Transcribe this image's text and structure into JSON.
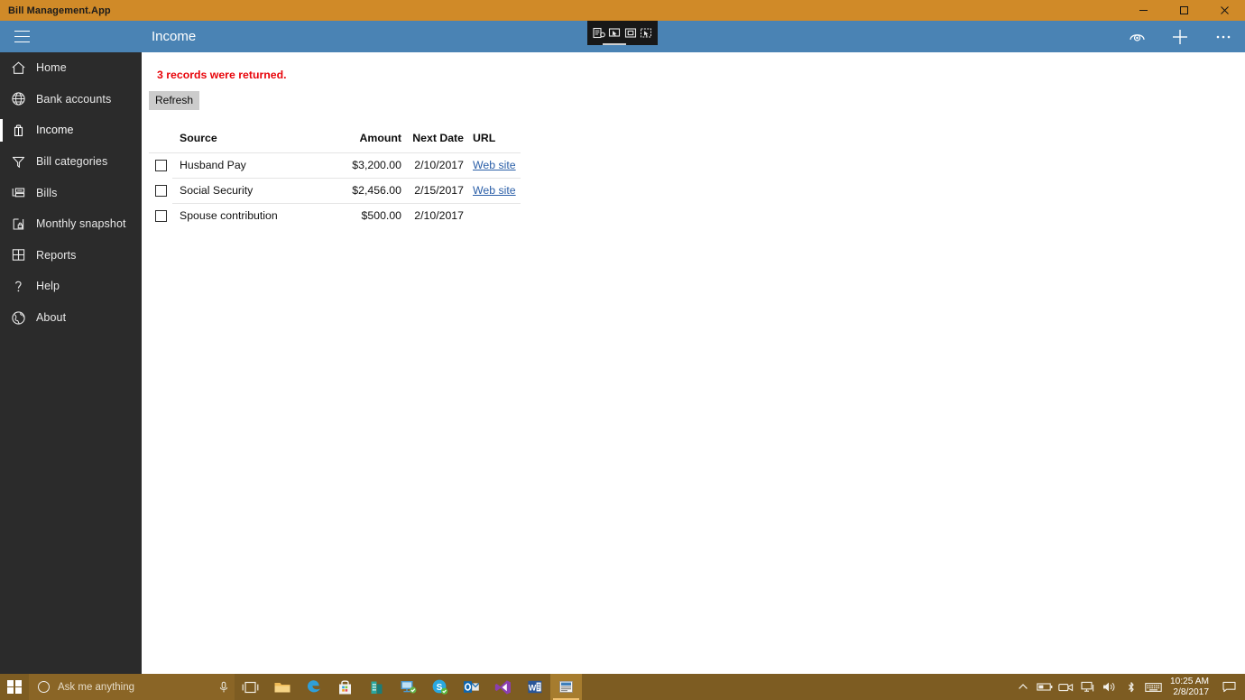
{
  "window": {
    "title": "Bill Management.App",
    "controls": {
      "minimize": "Minimize",
      "maximize": "Maximize",
      "close": "Close"
    }
  },
  "appbar": {
    "menu_label": "Menu",
    "title": "Income",
    "actions": [
      {
        "name": "view-icon",
        "label": "View"
      },
      {
        "name": "add-icon",
        "label": "Add"
      },
      {
        "name": "more-icon",
        "label": "More"
      }
    ]
  },
  "capture_toolbar": {
    "buttons": [
      {
        "name": "capture-screen-icon",
        "label": "Screen capture"
      },
      {
        "name": "capture-window-icon",
        "label": "Window capture"
      },
      {
        "name": "capture-region-icon",
        "label": "Region capture"
      },
      {
        "name": "capture-freeform-icon",
        "label": "Freeform capture"
      }
    ]
  },
  "sidebar": {
    "selected": "Income",
    "items": [
      {
        "label": "Home",
        "icon": "home-icon"
      },
      {
        "label": "Bank accounts",
        "icon": "globe-icon"
      },
      {
        "label": "Income",
        "icon": "bag-icon"
      },
      {
        "label": "Bill categories",
        "icon": "funnel-icon"
      },
      {
        "label": "Bills",
        "icon": "bills-icon"
      },
      {
        "label": "Monthly snapshot",
        "icon": "snapshot-lock-icon"
      },
      {
        "label": "Reports",
        "icon": "grid-icon"
      },
      {
        "label": "Help",
        "icon": "question-icon"
      },
      {
        "label": "About",
        "icon": "world-icon"
      }
    ]
  },
  "content": {
    "status_message": "3 records were returned.",
    "status_color": "#e8050b",
    "refresh_label": "Refresh",
    "table": {
      "columns": [
        "Source",
        "Amount",
        "Next Date",
        "URL"
      ],
      "rows": [
        {
          "checked": false,
          "source": "Husband Pay",
          "amount": "$3,200.00",
          "next_date": "2/10/2017",
          "url_label": "Web site",
          "has_url": true
        },
        {
          "checked": false,
          "source": "Social Security",
          "amount": "$2,456.00",
          "next_date": "2/15/2017",
          "url_label": "Web site",
          "has_url": true
        },
        {
          "checked": false,
          "source": "Spouse contribution",
          "amount": "$500.00",
          "next_date": "2/10/2017",
          "url_label": "",
          "has_url": false
        }
      ]
    }
  },
  "taskbar": {
    "start_label": "Start",
    "search_placeholder": "Ask me anything",
    "mic_label": "Microphone",
    "apps": [
      {
        "name": "task-view-icon",
        "label": "Task View"
      },
      {
        "name": "file-explorer-icon",
        "label": "File Explorer"
      },
      {
        "name": "edge-browser-icon",
        "label": "Microsoft Edge"
      },
      {
        "name": "store-icon",
        "label": "Store"
      },
      {
        "name": "office-icon",
        "label": "Office"
      },
      {
        "name": "remote-desktop-icon",
        "label": "Remote Desktop"
      },
      {
        "name": "skype-icon",
        "label": "Skype"
      },
      {
        "name": "outlook-icon",
        "label": "Outlook"
      },
      {
        "name": "visual-studio-icon",
        "label": "Visual Studio"
      },
      {
        "name": "word-icon",
        "label": "Word"
      },
      {
        "name": "bill-management-icon",
        "label": "Bill Management.App"
      }
    ],
    "tray": [
      {
        "name": "show-hidden-icons-icon",
        "label": "Show hidden icons"
      },
      {
        "name": "battery-icon",
        "label": "Battery"
      },
      {
        "name": "camera-icon",
        "label": "Camera"
      },
      {
        "name": "network-icon",
        "label": "Network"
      },
      {
        "name": "volume-icon",
        "label": "Volume"
      },
      {
        "name": "bluetooth-icon",
        "label": "Bluetooth"
      },
      {
        "name": "keyboard-icon",
        "label": "Touch keyboard"
      }
    ],
    "clock": {
      "time": "10:25 AM",
      "date": "2/8/2017"
    },
    "notifications_label": "Action Center"
  },
  "colors": {
    "titlebar": "#d08a28",
    "appbar": "#4a83b4",
    "sidebar": "#2b2b2b",
    "taskbar": "#7d5c22",
    "link": "#2b5fa8",
    "alert": "#e8050b"
  }
}
